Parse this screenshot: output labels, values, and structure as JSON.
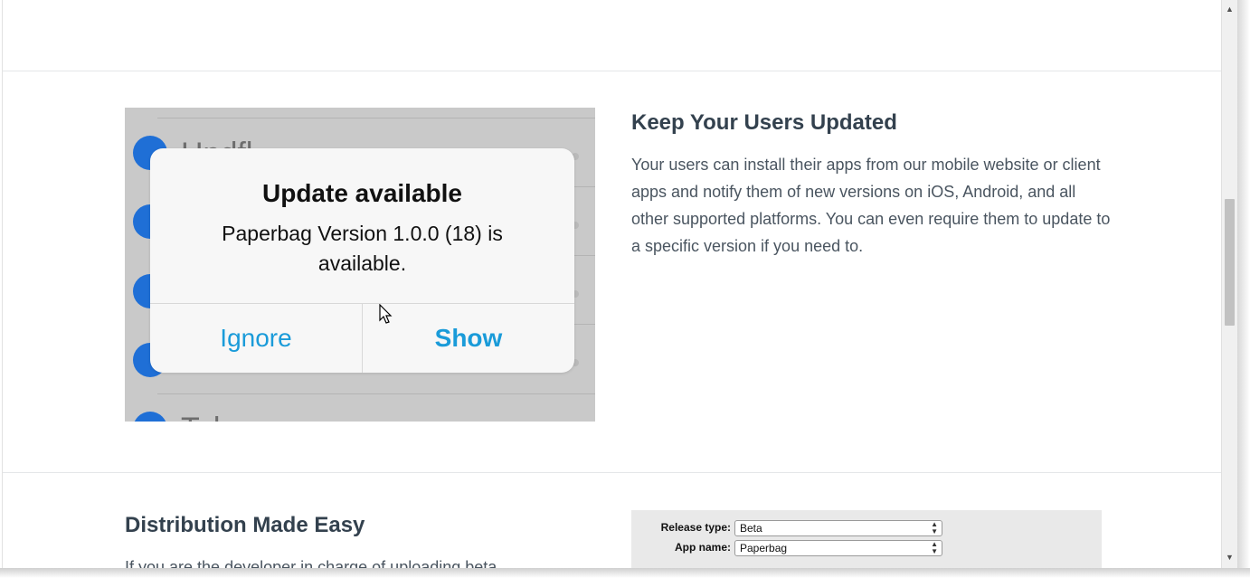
{
  "alert": {
    "title": "Update available",
    "message": "Paperbag Version 1.0.0 (18) is available.",
    "ignore_label": "Ignore",
    "show_label": "Show"
  },
  "section_updates": {
    "heading": "Keep Your Users Updated",
    "body": "Your users can install their apps from our mobile website or client apps and notify them of new versions on iOS, Android, and all other supported platforms. You can even require them to update to a specific version if you need to."
  },
  "section_distribution": {
    "heading": "Distribution Made Easy",
    "body_partial": "If you are the developer in charge of uploading beta"
  },
  "form_mock": {
    "release_type_label": "Release type:",
    "release_type_value": "Beta",
    "app_name_label": "App name:",
    "app_name_value": "Paperbag"
  },
  "colors": {
    "heading": "#33414e",
    "body_text": "#4a5560",
    "alert_button": "#1a9bd9",
    "avatar_blue": "#1f6fd6"
  },
  "icons": {
    "scroll_up": "triangle-up-icon",
    "scroll_down": "triangle-down-icon",
    "cursor": "mouse-pointer-icon"
  }
}
